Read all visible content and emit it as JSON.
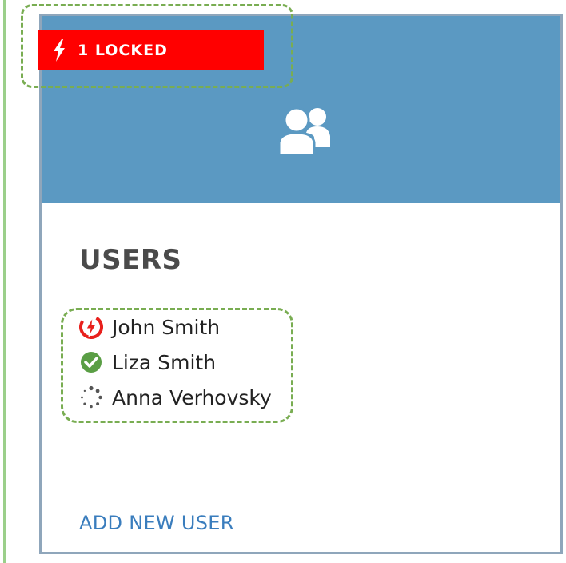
{
  "badge": {
    "text": "1 LOCKED",
    "color": "#ff0000",
    "icon": "lightning-bolt-icon"
  },
  "card": {
    "header_color": "#5b99c2",
    "header_icon": "users-group-icon",
    "title": "USERS",
    "users": [
      {
        "name": "John Smith",
        "status": "locked",
        "icon": "locked-bolt-icon",
        "icon_color": "#e8201c"
      },
      {
        "name": "Liza Smith",
        "status": "active",
        "icon": "check-circle-icon",
        "icon_color": "#5a9e45"
      },
      {
        "name": "Anna Verhovsky",
        "status": "pending",
        "icon": "spinner-icon",
        "icon_color": "#555555"
      }
    ],
    "add_user_label": "ADD NEW USER"
  },
  "highlight_color": "#79ad52"
}
